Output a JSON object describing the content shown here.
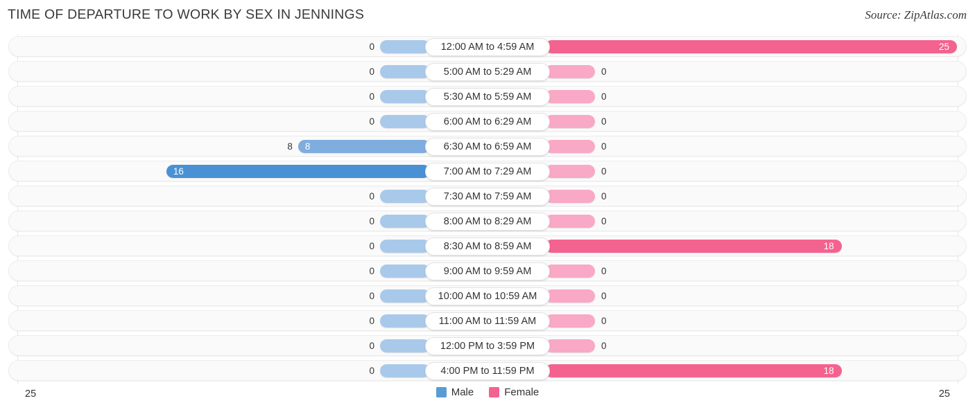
{
  "header": {
    "title": "TIME OF DEPARTURE TO WORK BY SEX IN JENNINGS",
    "source": "Source: ZipAtlas.com"
  },
  "axis": {
    "left_label": "25",
    "right_label": "25"
  },
  "legend": {
    "items": [
      {
        "label": "Male",
        "color": "#5b9bd5"
      },
      {
        "label": "Female",
        "color": "#f4628f"
      }
    ]
  },
  "colors": {
    "male_strong": "#4a90d4",
    "male_mid": "#7fadde",
    "male_zero": "#a9c9ea",
    "female_strong": "#f4628f",
    "female_zero": "#f9a8c6",
    "track": "#fafafa",
    "track_border": "#ececec",
    "gridline": "#e6e6e6",
    "text": "#333333"
  },
  "chart_data": {
    "type": "bar",
    "title": "TIME OF DEPARTURE TO WORK BY SEX IN JENNINGS",
    "orientation": "horizontal-diverging",
    "xlabel": "",
    "ylabel": "",
    "xlim": [
      25,
      25
    ],
    "grid": false,
    "legend_position": "bottom-center",
    "categories": [
      "12:00 AM to 4:59 AM",
      "5:00 AM to 5:29 AM",
      "5:30 AM to 5:59 AM",
      "6:00 AM to 6:29 AM",
      "6:30 AM to 6:59 AM",
      "7:00 AM to 7:29 AM",
      "7:30 AM to 7:59 AM",
      "8:00 AM to 8:29 AM",
      "8:30 AM to 8:59 AM",
      "9:00 AM to 9:59 AM",
      "10:00 AM to 10:59 AM",
      "11:00 AM to 11:59 AM",
      "12:00 PM to 3:59 PM",
      "4:00 PM to 11:59 PM"
    ],
    "series": [
      {
        "name": "Male",
        "color": "#5b9bd5",
        "values": [
          0,
          0,
          0,
          0,
          8,
          16,
          0,
          0,
          0,
          0,
          0,
          0,
          0,
          0
        ]
      },
      {
        "name": "Female",
        "color": "#f4628f",
        "values": [
          25,
          0,
          0,
          0,
          0,
          0,
          0,
          0,
          18,
          0,
          0,
          0,
          0,
          18
        ]
      }
    ]
  }
}
